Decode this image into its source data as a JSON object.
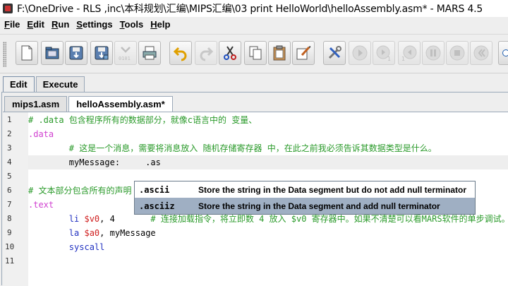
{
  "window": {
    "title": "F:\\OneDrive - RLS ,inc\\本科规划\\汇编\\MIPS汇编\\03 print HelloWorld\\helloAssembly.asm* - MARS 4.5"
  },
  "menu": [
    {
      "label": "File",
      "u": "F",
      "rest": "ile"
    },
    {
      "label": "Edit",
      "u": "E",
      "rest": "dit"
    },
    {
      "label": "Run",
      "u": "R",
      "rest": "un"
    },
    {
      "label": "Settings",
      "u": "S",
      "rest": "ettings"
    },
    {
      "label": "Tools",
      "u": "T",
      "rest": "ools"
    },
    {
      "label": "Help",
      "u": "H",
      "rest": "elp"
    }
  ],
  "toolbar": {
    "buttons": [
      "new-file",
      "open-file",
      "save",
      "save-all",
      "dump-memory",
      "print",
      "undo",
      "redo",
      "cut",
      "copy",
      "paste",
      "find-replace",
      "assemble",
      "run",
      "step",
      "backstep",
      "pause",
      "stop",
      "reset"
    ],
    "dump_label": "0101"
  },
  "outer_tabs": [
    {
      "label": "Edit",
      "active": true
    },
    {
      "label": "Execute",
      "active": false
    }
  ],
  "file_tabs": [
    {
      "label": "mips1.asm",
      "active": false
    },
    {
      "label": "helloAssembly.asm*",
      "active": true
    }
  ],
  "editor": {
    "line_numbers": [
      "1",
      "2",
      "3",
      "4",
      "5",
      "6",
      "7",
      "8",
      "9",
      "10",
      "11"
    ],
    "lines": {
      "l1": "# .data 包含程序所有的数据部分，就像c语言中的 变量、",
      "l2": ".data",
      "l3": "        # 这是一个消息，需要将消息放入 随机存储寄存器 中，在此之前我必须告诉其数据类型是什么。",
      "l4_label": "        myMessage:",
      "l4_dir": "     .as",
      "l6": "# 文本部分包含所有的声明",
      "l7": ".text",
      "l8_op": "        li ",
      "l8_reg": "$v0",
      "l8_rest": ", 4",
      "l8_comment": "       # 连接加载指令，将立即数 4 放入 $v0 寄存器中。如果不清楚可以看MARS软件的单步调试。",
      "l9_op": "        la ",
      "l9_reg": "$a0",
      "l9_rest": ", myMessage",
      "l10": "        syscall"
    }
  },
  "autocomplete": {
    "items": [
      {
        "key": ".ascii",
        "desc": "Store the string in the Data segment but do not add null terminator",
        "selected": false
      },
      {
        "key": ".asciiz",
        "desc": "Store the string in the Data segment and add null terminator",
        "selected": true
      }
    ]
  }
}
